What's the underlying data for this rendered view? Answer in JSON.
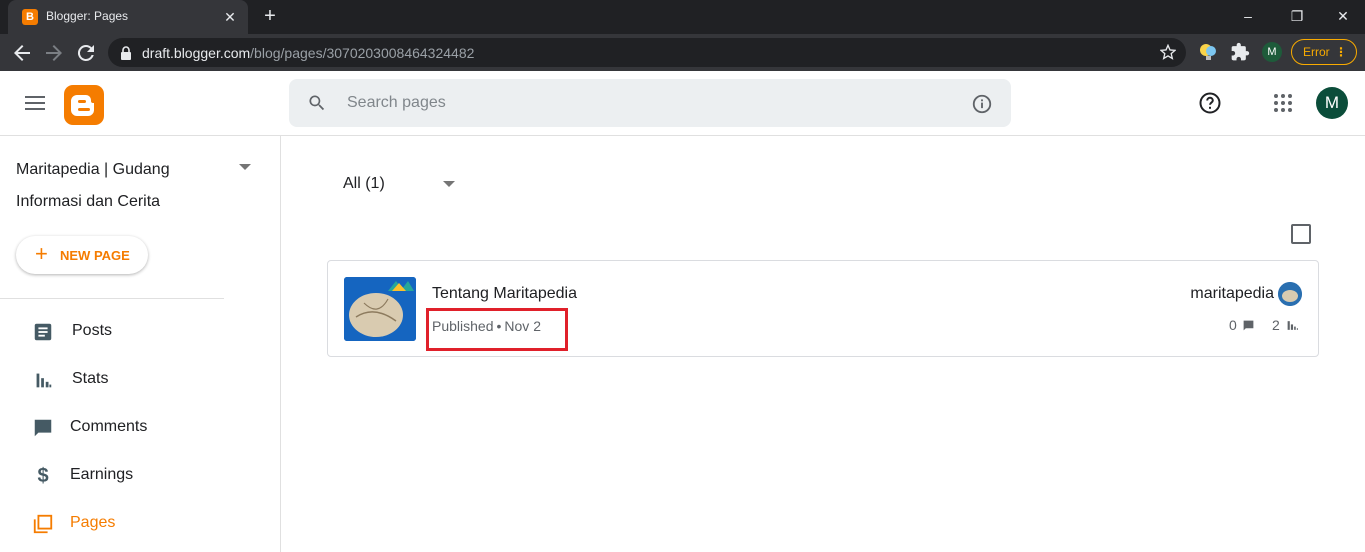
{
  "browser": {
    "tab_title": "Blogger: Pages",
    "tab_favicon_letter": "B",
    "url_host": "draft.blogger.com",
    "url_path": "/blog/pages/3070203008464324482",
    "profile_letter": "M",
    "error_label": "Error"
  },
  "header": {
    "search_placeholder": "Search pages",
    "avatar_letter": "M"
  },
  "sidebar": {
    "blog_name": "Maritapedia | Gudang Informasi dan Cerita",
    "new_page_label": "NEW PAGE",
    "items": [
      {
        "label": "Posts",
        "icon": "posts-icon"
      },
      {
        "label": "Stats",
        "icon": "stats-icon"
      },
      {
        "label": "Comments",
        "icon": "comments-icon"
      },
      {
        "label": "Earnings",
        "icon": "earnings-icon"
      },
      {
        "label": "Pages",
        "icon": "pages-icon",
        "active": true
      }
    ]
  },
  "main": {
    "filter_label": "All (1)",
    "pages": [
      {
        "title": "Tentang Maritapedia",
        "status": "Published",
        "date": "Nov 2",
        "author": "maritapedia",
        "comments": "0",
        "views": "2"
      }
    ]
  },
  "colors": {
    "accent": "#f57c00",
    "highlight": "#e0202a"
  }
}
